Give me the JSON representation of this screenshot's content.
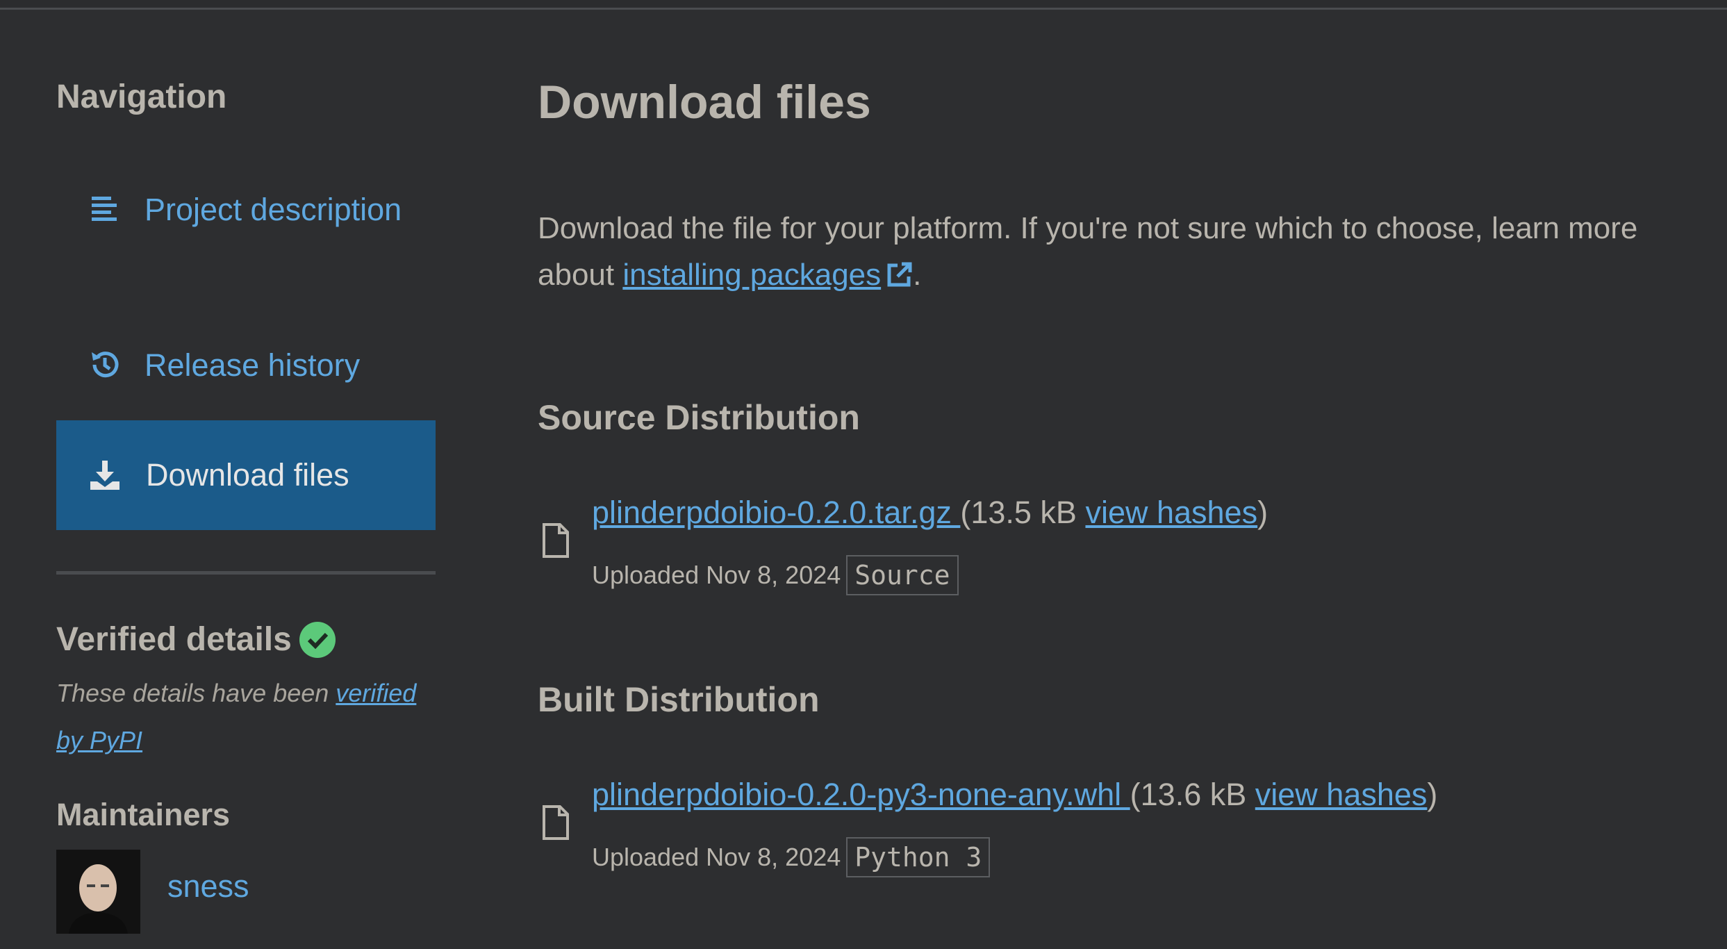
{
  "navigation": {
    "heading": "Navigation",
    "items": [
      {
        "label": "Project description",
        "icon": "align-left-icon"
      },
      {
        "label": "Release history",
        "icon": "history-icon"
      },
      {
        "label": "Download files",
        "icon": "download-icon",
        "active": true
      }
    ]
  },
  "verified": {
    "heading": "Verified details",
    "note_prefix": "These details have been ",
    "note_link": "verified by PyPI"
  },
  "maintainers": {
    "heading": "Maintainers",
    "users": [
      {
        "name": "sness"
      }
    ]
  },
  "main": {
    "title": "Download files",
    "intro_text": "Download the file for your platform. If you're not sure which to choose, learn more about ",
    "intro_link": "installing packages",
    "intro_suffix": ".",
    "sections": [
      {
        "title": "Source Distribution",
        "file": {
          "name": "plinderpdoibio-0.2.0.tar.gz ",
          "size": "(13.5 kB ",
          "hashes_link": "view hashes",
          "close": ")",
          "uploaded": "Uploaded Nov 8, 2024",
          "tag": "Source"
        }
      },
      {
        "title": "Built Distribution",
        "file": {
          "name": "plinderpdoibio-0.2.0-py3-none-any.whl ",
          "size": "(13.6 kB ",
          "hashes_link": "view hashes",
          "close": ")",
          "uploaded": "Uploaded Nov 8, 2024",
          "tag": "Python 3"
        }
      }
    ]
  },
  "colors": {
    "background": "#2d2e30",
    "link": "#5fa8e0",
    "active_nav": "#1b5b8a",
    "verified_check": "#5cc97a"
  }
}
